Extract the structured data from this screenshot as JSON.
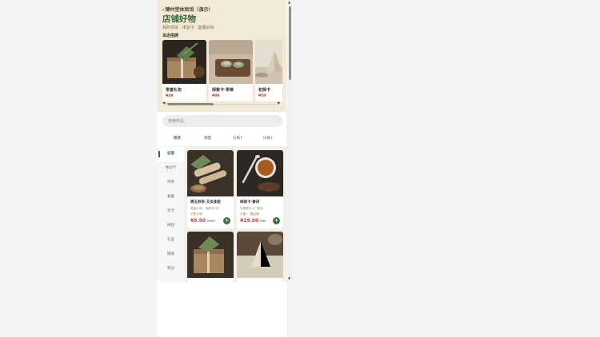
{
  "header": {
    "back_label": "臻仲堂体验馆（演示）",
    "title": "店铺好物",
    "subtitle": "我的项目 · 体验卡 · 套餐好物",
    "featured_label": "本店招牌"
  },
  "featured": [
    {
      "name": "茶盒礼包",
      "price": "¥49"
    },
    {
      "name": "探索卡·茶禅",
      "price": "¥99"
    },
    {
      "name": "初探卡",
      "price": "¥59"
    }
  ],
  "search": {
    "placeholder": "搜索商品"
  },
  "tabs": [
    {
      "label": "综合"
    },
    {
      "label": "销量"
    },
    {
      "label": "价格↑"
    },
    {
      "label": "价格↓"
    }
  ],
  "sidebar": [
    {
      "label": "全部"
    },
    {
      "label": "体验卡"
    },
    {
      "label": "单项"
    },
    {
      "label": "套餐"
    },
    {
      "label": "年卡"
    },
    {
      "label": "拼团"
    },
    {
      "label": "礼盒"
    },
    {
      "label": "储值"
    },
    {
      "label": "积分"
    }
  ],
  "products": [
    {
      "name": "周五秒杀·艾灸体验",
      "desc": "限量50份，每账号1份",
      "sold": "已售13份",
      "price": "¥9.90",
      "old_price": "¥128"
    },
    {
      "name": "体验卡·香讲",
      "desc": "仅限首次入门体验",
      "sold": "已售1 · 限店铺",
      "price": "¥19.90",
      "old_price": "¥80"
    },
    {
      "name": "",
      "desc": "",
      "sold": "",
      "price": "",
      "old_price": ""
    },
    {
      "name": "",
      "desc": "",
      "sold": "",
      "price": "",
      "old_price": ""
    }
  ],
  "icons": {
    "back": "chevron-left-icon",
    "add": "plus-icon",
    "scroll_left": "arrow-left-icon",
    "scroll_right": "arrow-right-icon"
  },
  "colors": {
    "brand_green": "#3b6b3a",
    "price_red": "#d23b2f",
    "header_bg": "#f2ead6"
  }
}
